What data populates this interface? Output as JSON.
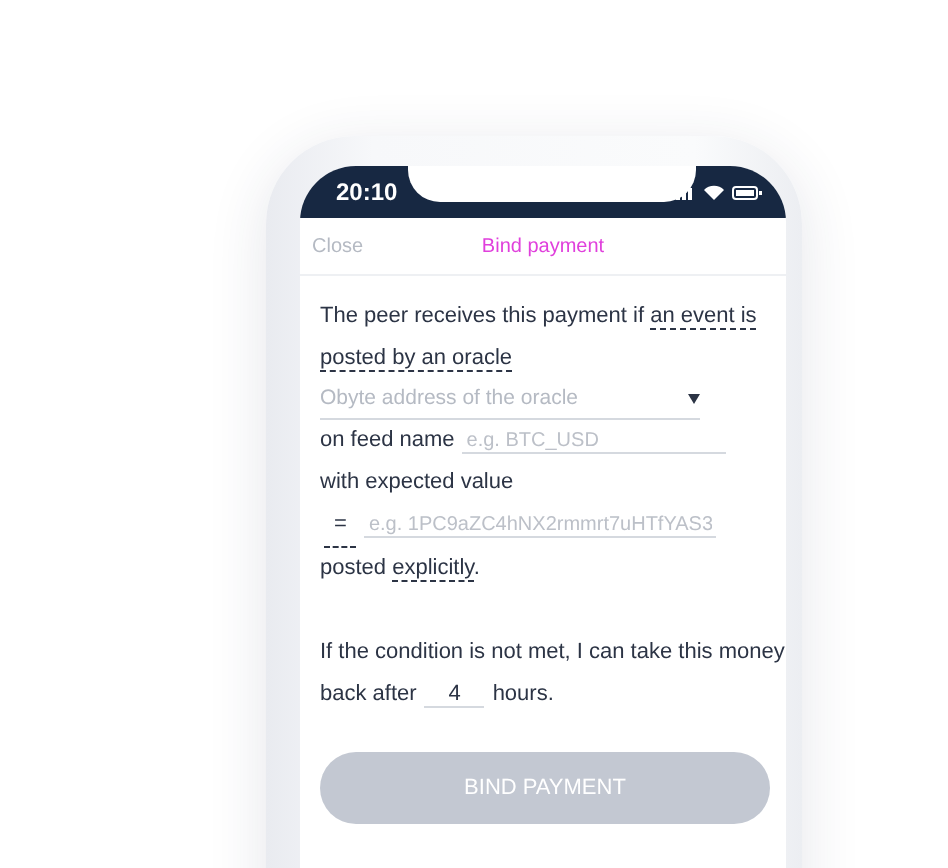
{
  "status_bar": {
    "time": "20:10"
  },
  "nav": {
    "close": "Close",
    "title": "Bind payment"
  },
  "form": {
    "intro": "The peer receives this payment if",
    "event_type": [
      "an event is",
      "posted by an oracle"
    ],
    "oracle_select": {
      "placeholder": "Obyte address of the oracle"
    },
    "feed_label": "on feed name",
    "feed_field": {
      "placeholder": "e.g. BTC_USD"
    },
    "value_label": "with expected value",
    "operator": "=",
    "value_field": {
      "placeholder": "e.g. 1PC9aZC4hNX2rmmrt7uHTfYAS3"
    },
    "posted_prefix": "posted",
    "posted_mode": "explicitly",
    "posted_suffix": ".",
    "refund_text": [
      "If the condition is not met, I can take this money",
      "back after"
    ],
    "hours_field": {
      "value": "4"
    },
    "hours_unit": "hours."
  },
  "button": {
    "label": "BIND PAYMENT",
    "disabled": true
  }
}
